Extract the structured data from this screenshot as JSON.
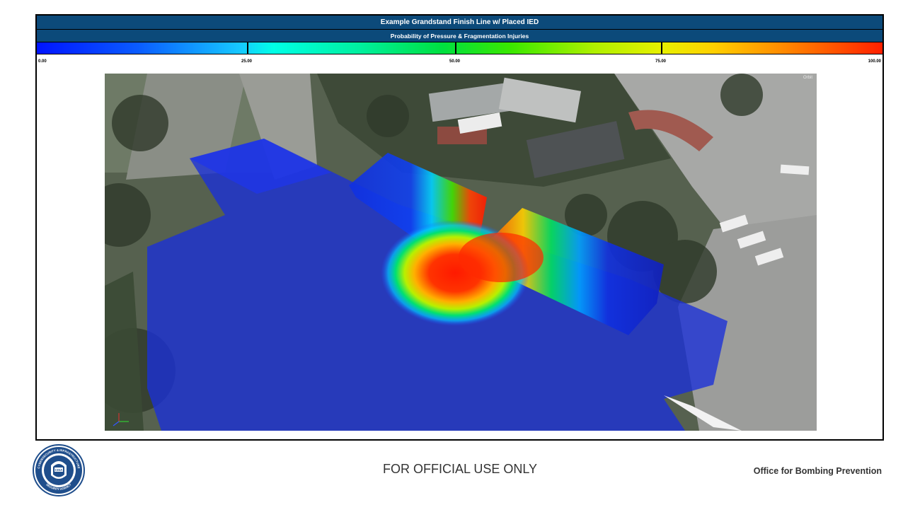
{
  "slide": {
    "title": "Example Grandstand Finish Line w/ Placed IED",
    "subtitle": "Probability of Pressure & Fragmentation Injuries",
    "scale_labels": [
      "0.00",
      "25.00",
      "50.00",
      "75.00",
      "100.00"
    ],
    "viewer_mode": "Orbit"
  },
  "footer": {
    "classification": "FOR OFFICIAL USE ONLY",
    "office": "Office for Bombing Prevention"
  },
  "seal": {
    "text_outer_top": "CYBERSECURITY & INFRASTRUCTURE",
    "text_outer_bottom": "SECURITY AGENCY",
    "text_center": "CISA"
  },
  "colors": {
    "header_bar": "#0c4a7a",
    "seal_blue": "#1f4e8c"
  }
}
